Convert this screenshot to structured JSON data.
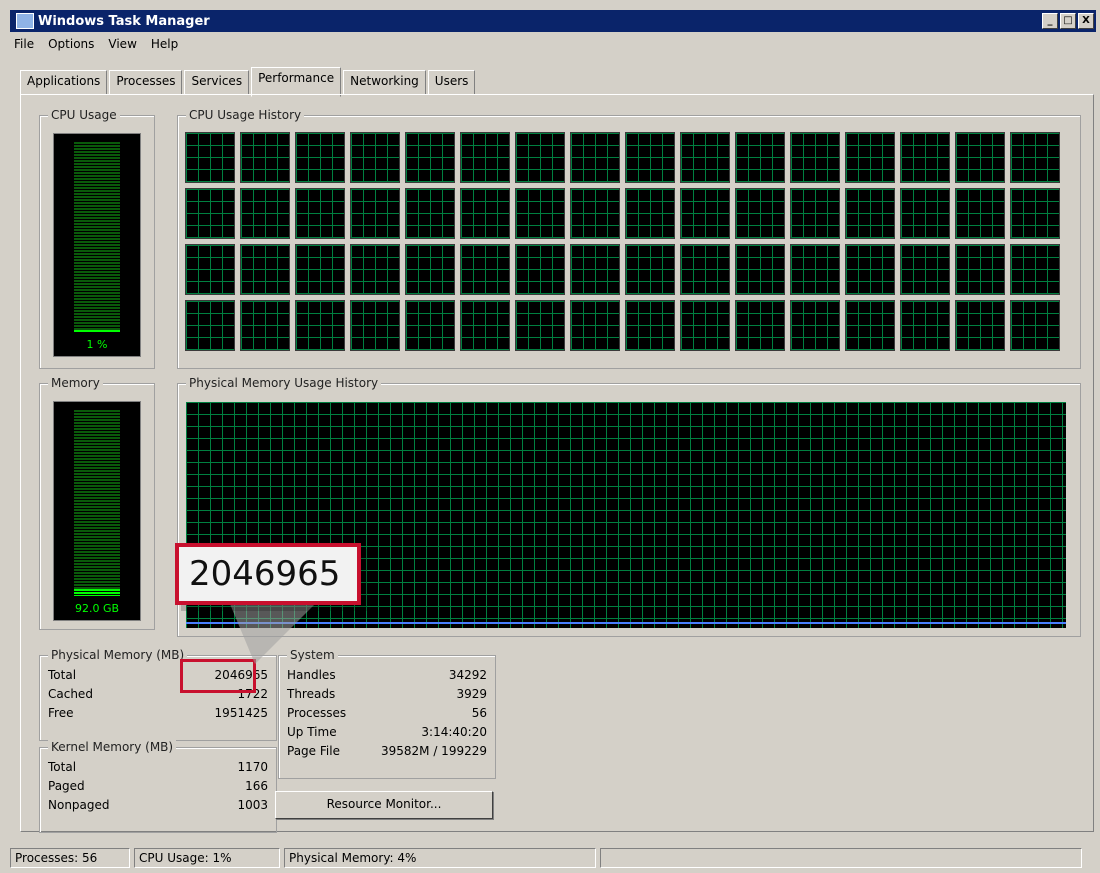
{
  "window": {
    "title": "Windows Task Manager",
    "buttons": [
      "_",
      "□",
      "X"
    ]
  },
  "menu": [
    "File",
    "Options",
    "View",
    "Help"
  ],
  "tabs": [
    "Applications",
    "Processes",
    "Services",
    "Performance",
    "Networking",
    "Users"
  ],
  "active_tab": "Performance",
  "cpu": {
    "label": "CPU Usage",
    "value": "1 %",
    "history_label": "CPU Usage History",
    "graphs": 64
  },
  "memory": {
    "label": "Memory",
    "value": "92.0 GB",
    "history_label": "Physical Memory Usage History"
  },
  "physical_memory": {
    "label": "Physical Memory (MB)",
    "rows": [
      {
        "name": "Total",
        "value": "2046965"
      },
      {
        "name": "Cached",
        "value": "1722"
      },
      {
        "name": "Free",
        "value": "1951425"
      }
    ]
  },
  "kernel_memory": {
    "label": "Kernel Memory (MB)",
    "rows": [
      {
        "name": "Total",
        "value": "1170"
      },
      {
        "name": "Paged",
        "value": "166"
      },
      {
        "name": "Nonpaged",
        "value": "1003"
      }
    ]
  },
  "system": {
    "label": "System",
    "rows": [
      {
        "name": "Handles",
        "value": "34292"
      },
      {
        "name": "Threads",
        "value": "3929"
      },
      {
        "name": "Processes",
        "value": "56"
      },
      {
        "name": "Up Time",
        "value": "3:14:40:20"
      },
      {
        "name": "Page File",
        "value": "39582M / 199229"
      }
    ]
  },
  "resource_monitor_button": "Resource Monitor...",
  "highlight_value": "2046965",
  "status": {
    "processes": "Processes: 56",
    "cpu": "CPU Usage: 1%",
    "memory": "Physical Memory: 4%"
  },
  "colors": {
    "graph_green": "#00ff00",
    "grid_green": "#008040",
    "highlight_red": "#c8102e",
    "memory_line": "#4a7fff"
  }
}
